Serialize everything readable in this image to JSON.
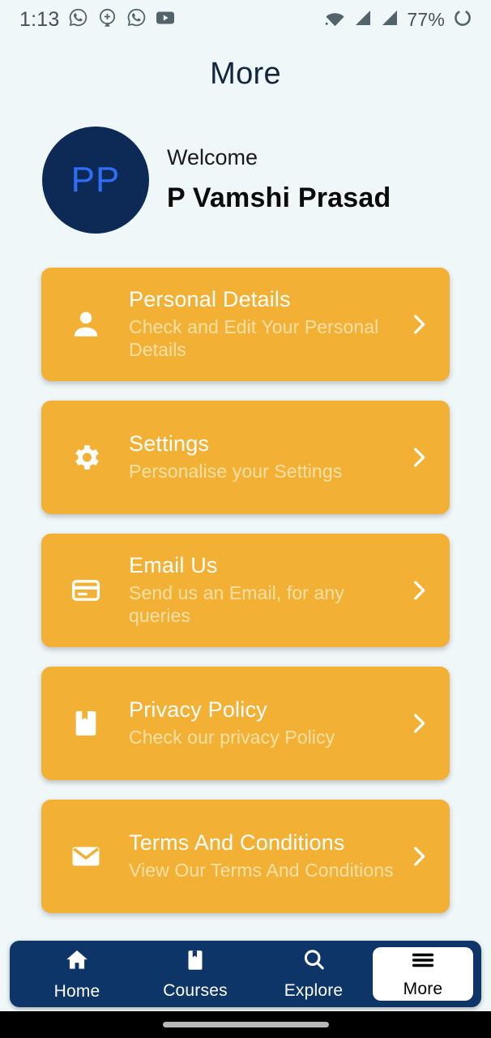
{
  "status_bar": {
    "time": "1:13",
    "battery_percent": "77%",
    "left_icons": [
      "whatsapp-icon",
      "plus-circle-icon",
      "whatsapp-icon",
      "youtube-icon"
    ],
    "right_icons": [
      "wifi-icon",
      "signal-icon",
      "signal-icon",
      "battery-icon"
    ]
  },
  "header": {
    "title": "More"
  },
  "profile": {
    "initials": "PP",
    "welcome_label": "Welcome",
    "name": "P Vamshi Prasad",
    "avatar_bg": "#0d2a57",
    "avatar_text_color": "#2f6df6"
  },
  "menu": {
    "card_color": "#f2b134",
    "items": [
      {
        "icon": "person-icon",
        "title": "Personal Details",
        "subtitle": "Check and Edit Your Personal Details"
      },
      {
        "icon": "gear-icon",
        "title": "Settings",
        "subtitle": "Personalise your Settings"
      },
      {
        "icon": "credit-card-icon",
        "title": "Email Us",
        "subtitle": "Send us an Email, for any queries"
      },
      {
        "icon": "book-bookmark-icon",
        "title": "Privacy Policy",
        "subtitle": "Check our privacy Policy"
      },
      {
        "icon": "envelope-icon",
        "title": "Terms And Conditions",
        "subtitle": "View Our Terms And Conditions"
      }
    ]
  },
  "bottom_nav": {
    "bar_color": "#0e3567",
    "active": "More",
    "items": [
      {
        "icon": "home-icon",
        "label": "Home"
      },
      {
        "icon": "book-bookmark-icon",
        "label": "Courses"
      },
      {
        "icon": "search-icon",
        "label": "Explore"
      },
      {
        "icon": "hamburger-icon",
        "label": "More"
      }
    ]
  }
}
